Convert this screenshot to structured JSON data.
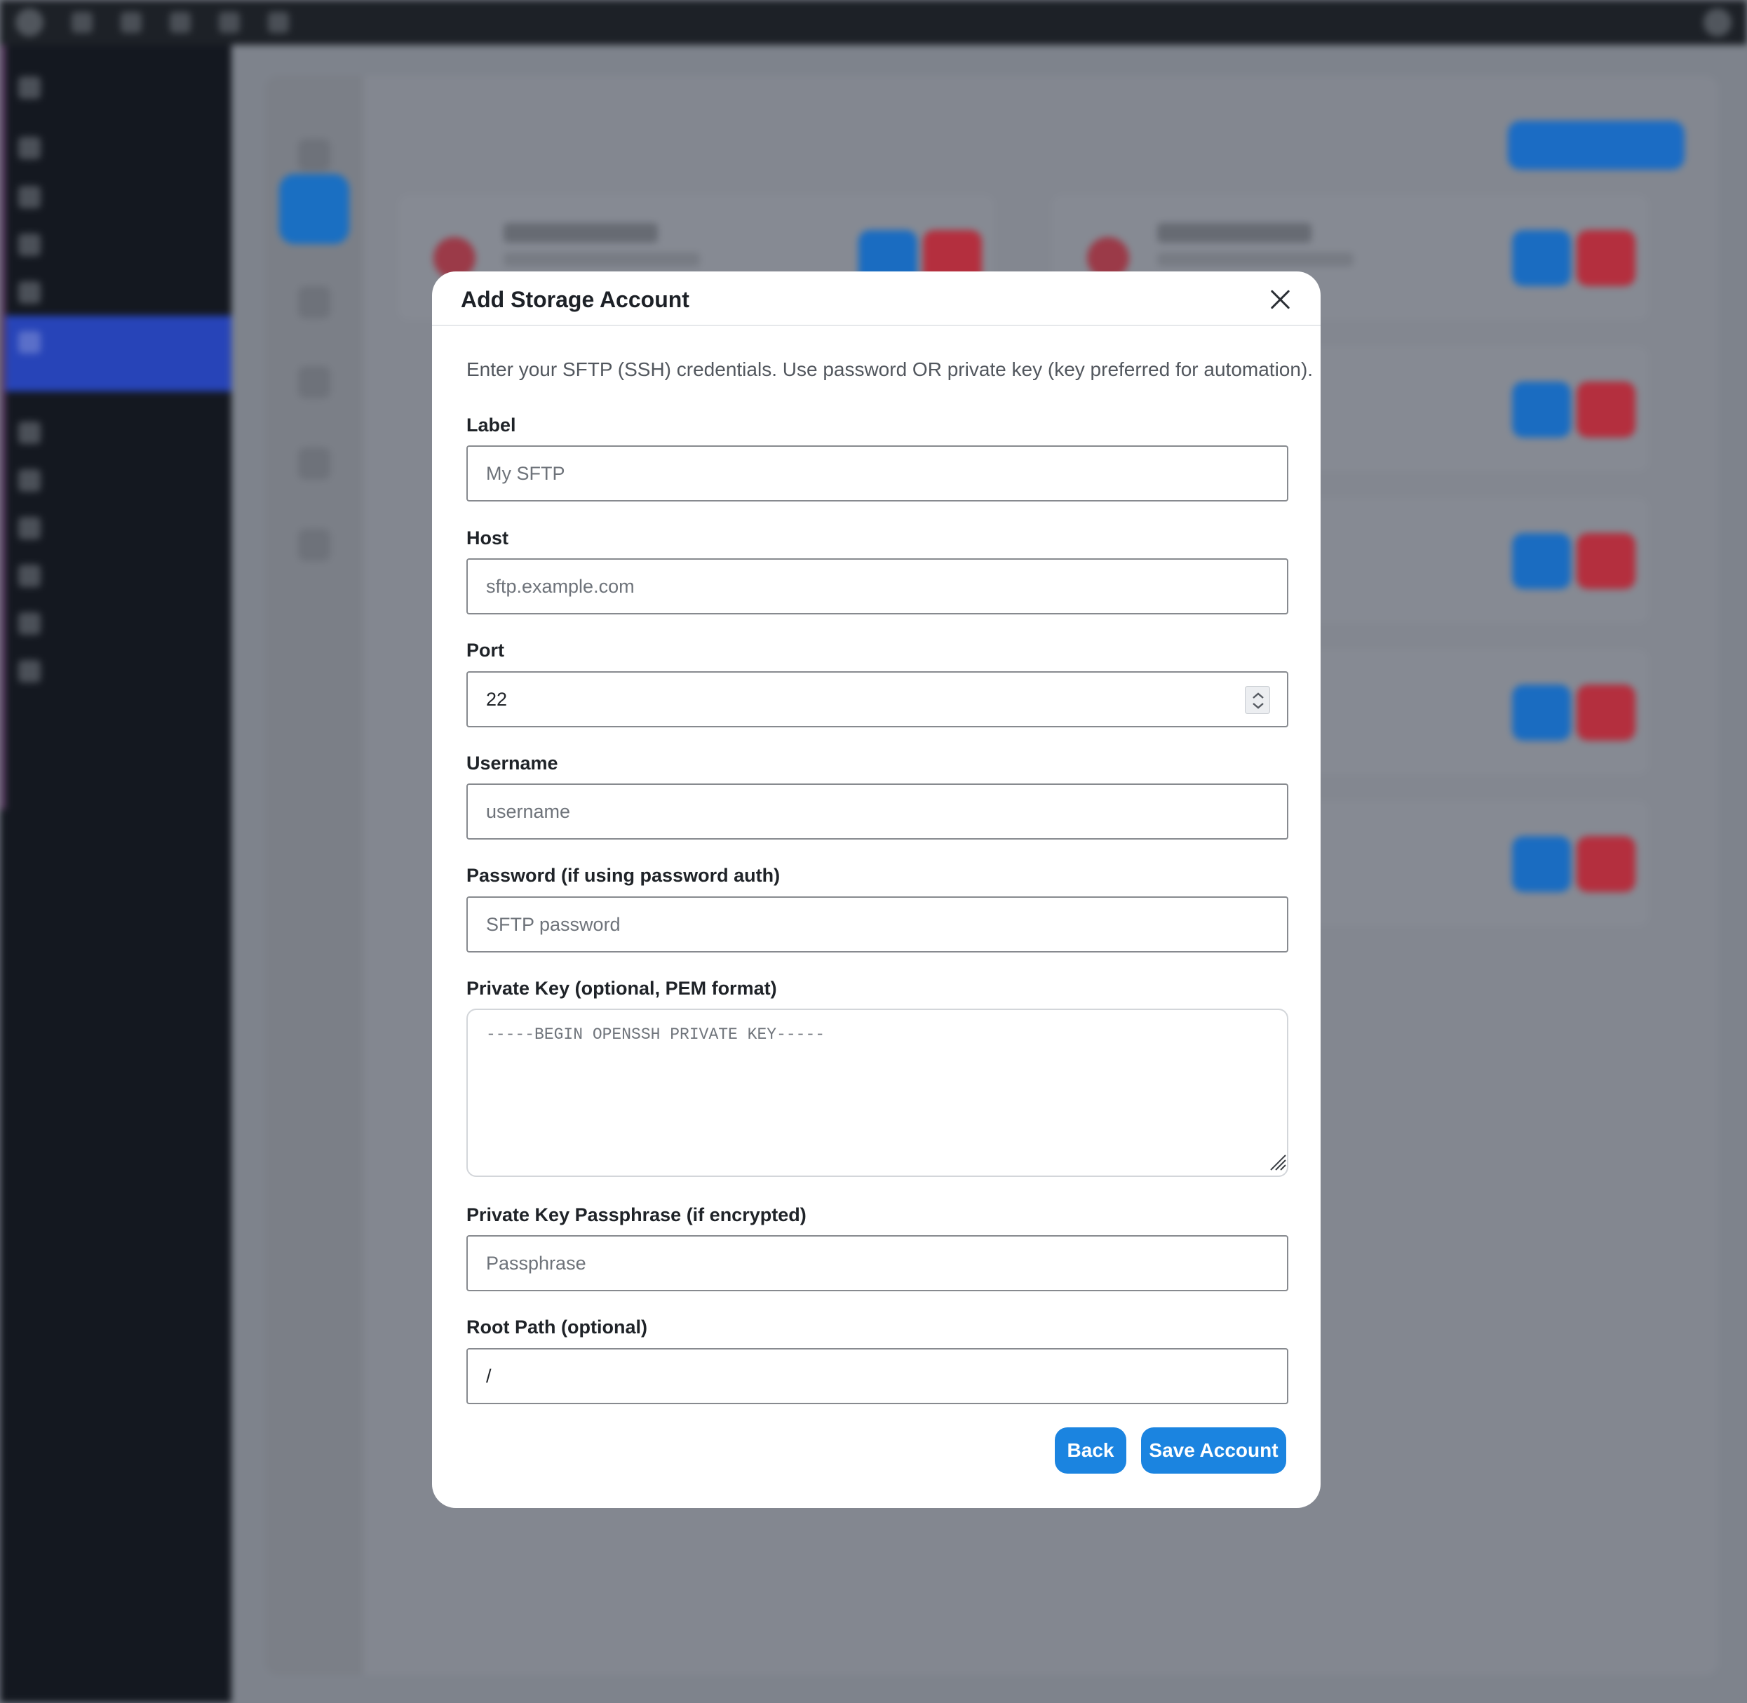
{
  "modal": {
    "title": "Add Storage Account",
    "intro": "Enter your SFTP (SSH) credentials. Use password OR private key (key preferred for automation).",
    "fields": {
      "label": {
        "label": "Label",
        "placeholder": "My SFTP"
      },
      "host": {
        "label": "Host",
        "placeholder": "sftp.example.com"
      },
      "port": {
        "label": "Port",
        "value": "22"
      },
      "username": {
        "label": "Username",
        "placeholder": "username"
      },
      "password": {
        "label": "Password (if using password auth)",
        "placeholder": "SFTP password"
      },
      "private_key": {
        "label": "Private Key (optional, PEM format)",
        "placeholder": "-----BEGIN OPENSSH PRIVATE KEY-----"
      },
      "passphrase": {
        "label": "Private Key Passphrase (if encrypted)",
        "placeholder": "Passphrase"
      },
      "root_path": {
        "label": "Root Path (optional)",
        "value": "/"
      }
    },
    "buttons": {
      "back": "Back",
      "save": "Save Account"
    }
  },
  "colors": {
    "primary_button": "#1b84e0",
    "overlay_background": "#7e838c",
    "admin_sidebar": "#141820"
  },
  "icons": {
    "close": "close-icon",
    "port_spinner": "spinner-icon",
    "textarea_resize": "resize-handle-icon"
  }
}
